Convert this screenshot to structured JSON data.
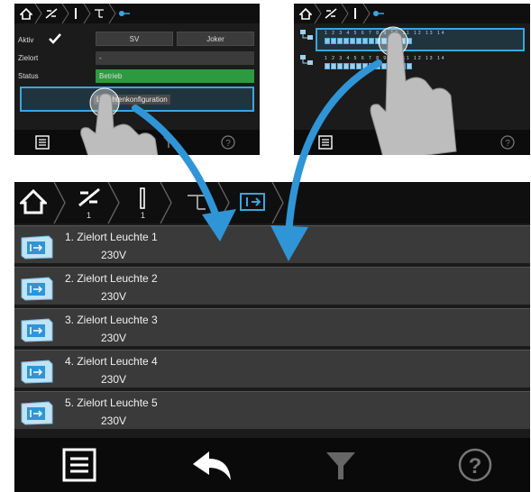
{
  "panel1": {
    "breadcrumb": [
      {
        "icon": "home-icon",
        "sub": ""
      },
      {
        "icon": "cross-lines-icon",
        "sub": "1"
      },
      {
        "icon": "bar-icon",
        "sub": "1"
      },
      {
        "icon": "tree-icon",
        "sub": ""
      },
      {
        "icon": "node-icon",
        "sub": ""
      }
    ],
    "aktiv_label": "Aktiv",
    "sv_label": "SV",
    "joker_label": "Joker",
    "zielort_label": "Zielort",
    "zielort_value": "-",
    "status_label": "Status",
    "status_value": "Betrieb",
    "config_button": "Leuchtenkonfiguration"
  },
  "panel2": {
    "breadcrumb": [
      {
        "icon": "home-icon",
        "sub": ""
      },
      {
        "icon": "cross-lines-icon",
        "sub": "1"
      },
      {
        "icon": "bar-icon",
        "sub": "1"
      },
      {
        "icon": "tree-icon",
        "sub": ""
      }
    ],
    "row1_numbers": "1 2 3 4 5 6 7 8 9 10 11 12 13 14",
    "row2_numbers": "1 2 3 4 5 6 7 8 9 10 11 12 13 14"
  },
  "main": {
    "breadcrumb": [
      {
        "icon": "home-icon",
        "sub": ""
      },
      {
        "icon": "cross-lines-icon",
        "sub": "1"
      },
      {
        "icon": "bar-icon",
        "sub": "1"
      },
      {
        "icon": "tree-icon",
        "sub": ""
      },
      {
        "icon": "exit-sign-icon",
        "sub": ""
      }
    ],
    "items": [
      {
        "title": "1. Zielort Leuchte 1",
        "voltage": "230V"
      },
      {
        "title": "2. Zielort Leuchte 2",
        "voltage": "230V"
      },
      {
        "title": "3. Zielort Leuchte 3",
        "voltage": "230V"
      },
      {
        "title": "4. Zielort Leuchte 4",
        "voltage": "230V"
      },
      {
        "title": "5. Zielort Leuchte 5",
        "voltage": "230V"
      }
    ],
    "footer": [
      {
        "icon": "list-icon"
      },
      {
        "icon": "back-arrow-icon"
      },
      {
        "icon": "filter-icon"
      },
      {
        "icon": "help-icon"
      }
    ]
  },
  "colors": {
    "accent": "#3aa6e0",
    "status_green": "#2d9a3f",
    "arrow_blue": "#2f95d6",
    "panel_bg": "#1b1b1b",
    "row_bg": "#3a3a3a"
  }
}
